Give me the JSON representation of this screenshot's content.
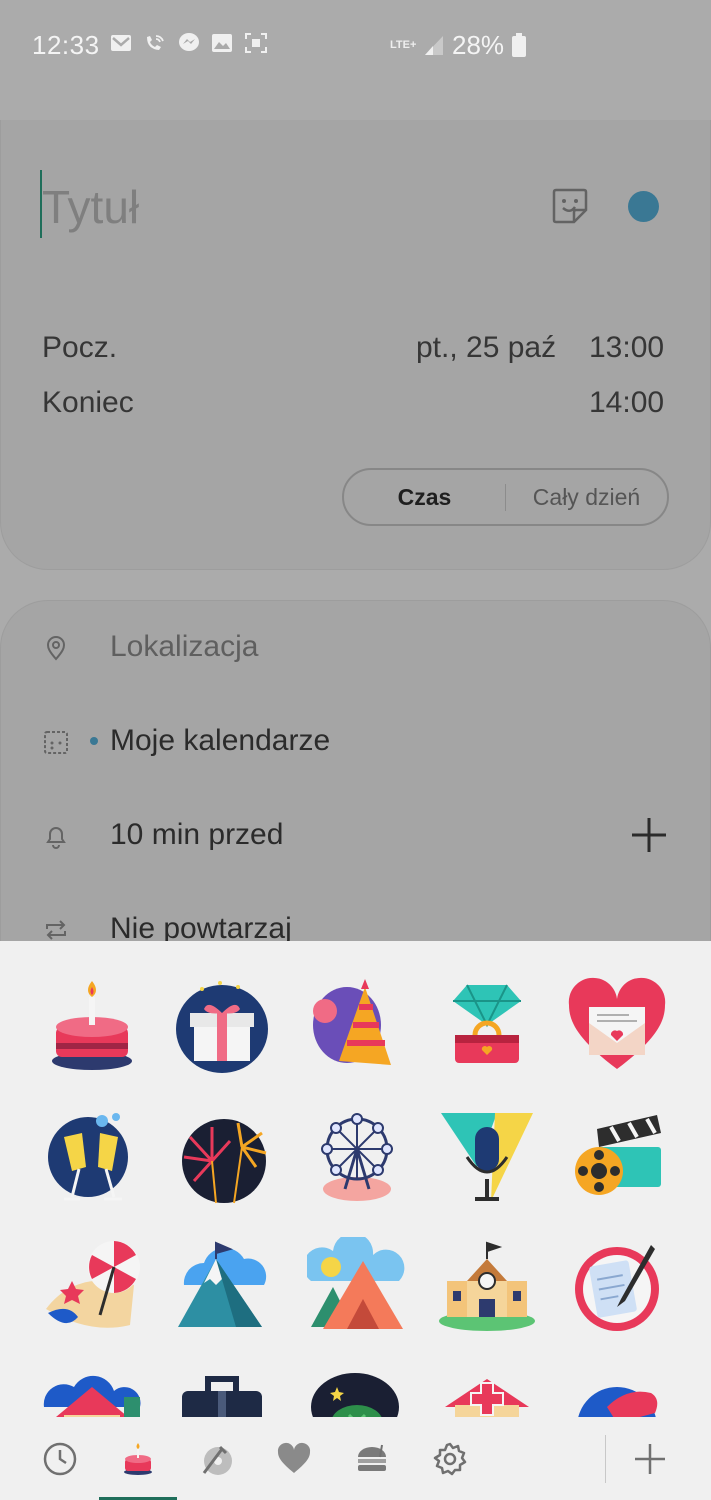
{
  "status_bar": {
    "time": "12:33",
    "network": "LTE+",
    "battery": "28%",
    "icons": [
      "gmail-icon",
      "wifi-call-icon",
      "messenger-icon",
      "gallery-icon",
      "screenshot-icon"
    ]
  },
  "event": {
    "title_placeholder": "Tytuł",
    "color": "#3a7894",
    "start_label": "Pocz.",
    "start_date": "pt., 25 paź",
    "start_time": "13:00",
    "end_label": "Koniec",
    "end_time": "14:00",
    "time_toggle": {
      "option_time": "Czas",
      "option_all_day": "Cały dzień",
      "selected": "Czas"
    }
  },
  "details": {
    "location_placeholder": "Lokalizacja",
    "calendar": "Moje kalendarze",
    "reminder": "10 min przed",
    "repeat": "Nie powtarzaj"
  },
  "sticker_panel": {
    "stickers": [
      "birthday-cake",
      "gift-box",
      "party-hat",
      "engagement-ring",
      "love-letter",
      "champagne-toast",
      "fireworks",
      "ferris-wheel",
      "microphone",
      "movie-clapper",
      "beach-umbrella",
      "mountains",
      "camping-tent",
      "school-building",
      "writing-note",
      "house",
      "briefcase",
      "money",
      "hospital",
      "shoe"
    ],
    "tabs": [
      "recent",
      "celebration",
      "hobby",
      "love",
      "food",
      "settings"
    ],
    "selected_tab": "celebration"
  }
}
